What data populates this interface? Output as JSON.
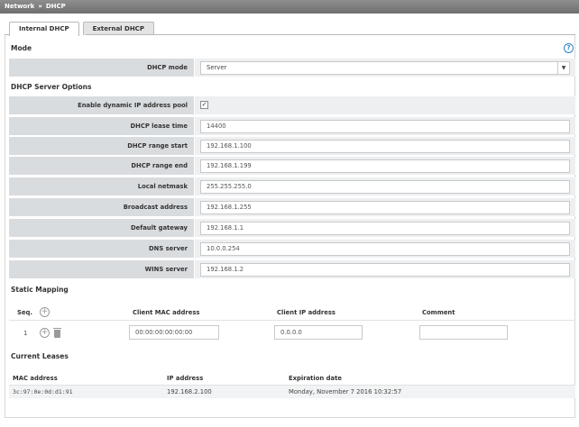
{
  "breadcrumb": {
    "root": "Network",
    "separator": "»",
    "current": "DHCP"
  },
  "tabs": [
    {
      "label": "Internal DHCP",
      "active": true
    },
    {
      "label": "External DHCP",
      "active": false
    }
  ],
  "help_icon": "help-circle-icon",
  "mode": {
    "title": "Mode",
    "dhcp_mode_label": "DHCP mode",
    "dhcp_mode_value": "Server"
  },
  "server_options": {
    "title": "DHCP Server Options",
    "dynamic_pool_label": "Enable dynamic IP address pool",
    "dynamic_pool_checked": true,
    "fields": [
      {
        "label": "DHCP lease time",
        "value": "14400"
      },
      {
        "label": "DHCP range start",
        "value": "192.168.1.100"
      },
      {
        "label": "DHCP range end",
        "value": "192.168.1.199"
      },
      {
        "label": "Local netmask",
        "value": "255.255.255.0"
      },
      {
        "label": "Broadcast address",
        "value": "192.168.1.255"
      },
      {
        "label": "Default gateway",
        "value": "192.168.1.1"
      },
      {
        "label": "DNS server",
        "value": "10.0.0.254"
      },
      {
        "label": "WINS server",
        "value": "192.168.1.2"
      }
    ]
  },
  "static_mapping": {
    "title": "Static Mapping",
    "columns": {
      "seq": "Seq.",
      "mac": "Client MAC address",
      "ip": "Client IP address",
      "comment": "Comment"
    },
    "rows": [
      {
        "seq": "1",
        "mac": "00:00:00:00:00:00",
        "ip": "0.0.0.0",
        "comment": ""
      }
    ]
  },
  "current_leases": {
    "title": "Current Leases",
    "columns": {
      "mac": "MAC address",
      "ip": "IP address",
      "expiration": "Expiration date"
    },
    "rows": [
      {
        "mac": "3c:97:0e:0d:d1:91",
        "ip": "192.168.2.100",
        "expiration": "Monday, November 7 2016 10:32:57"
      }
    ]
  },
  "colors": {
    "title_bar": "#7a7a7a",
    "label_bg": "#d9dcdf",
    "field_bg": "#edeff1",
    "help_blue": "#2a84c6"
  }
}
